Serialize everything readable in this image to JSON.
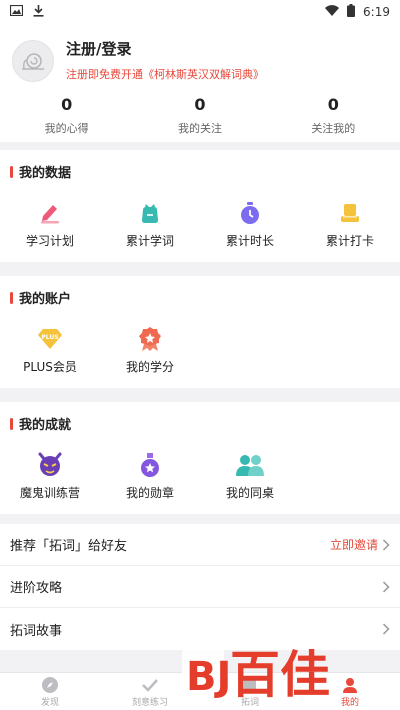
{
  "statusbar": {
    "time": "6:19"
  },
  "profile": {
    "login_title": "注册/登录",
    "login_subtitle": "注册即免费开通《柯林斯英汉双解词典》",
    "stats": [
      {
        "value": "0",
        "label": "我的心得"
      },
      {
        "value": "0",
        "label": "我的关注"
      },
      {
        "value": "0",
        "label": "关注我的"
      }
    ]
  },
  "sections": {
    "data": {
      "title": "我的数据",
      "items": [
        {
          "label": "学习计划",
          "icon": "pencil-icon"
        },
        {
          "label": "累计学词",
          "icon": "bag-icon"
        },
        {
          "label": "累计时长",
          "icon": "stopwatch-icon"
        },
        {
          "label": "累计打卡",
          "icon": "checkin-icon"
        }
      ]
    },
    "account": {
      "title": "我的账户",
      "items": [
        {
          "label": "PLUS会员",
          "icon": "plus-diamond-icon",
          "badge": "PLUS"
        },
        {
          "label": "我的学分",
          "icon": "ribbon-medal-icon"
        }
      ]
    },
    "achievements": {
      "title": "我的成就",
      "items": [
        {
          "label": "魔鬼训练营",
          "icon": "devil-icon"
        },
        {
          "label": "我的勋章",
          "icon": "medal-icon"
        },
        {
          "label": "我的同桌",
          "icon": "deskmate-icon"
        }
      ]
    }
  },
  "list": [
    {
      "label": "推荐「拓词」给好友",
      "action": "立即邀请"
    },
    {
      "label": "进阶攻略"
    },
    {
      "label": "拓词故事"
    }
  ],
  "tabbar": [
    {
      "label": "发现",
      "icon": "compass-icon",
      "active": false
    },
    {
      "label": "刻意练习",
      "icon": "check-icon",
      "active": false
    },
    {
      "label": "拓词",
      "icon": "book-icon",
      "active": false
    },
    {
      "label": "我的",
      "icon": "person-icon",
      "active": true
    }
  ],
  "watermark": {
    "text": "百佳",
    "logo": "BJ"
  },
  "colors": {
    "accent": "#e8473a",
    "pink": "#ef5a7a",
    "teal": "#36b9b0",
    "purple": "#7b6cf0",
    "gold": "#f5c23b"
  }
}
